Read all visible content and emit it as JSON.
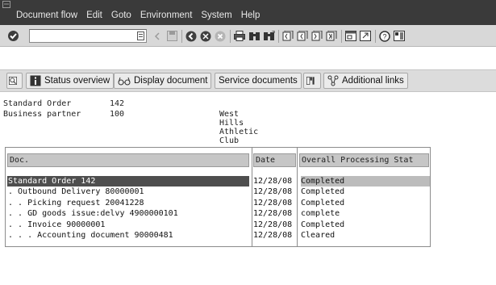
{
  "menubar": {
    "items": [
      "Document flow",
      "Edit",
      "Goto",
      "Environment",
      "System",
      "Help"
    ]
  },
  "toolbar": {
    "command_value": "",
    "icons": [
      "ok-icon",
      "back-icon",
      "exit-icon",
      "cancel-icon",
      "print-icon",
      "find-icon",
      "find-next-icon",
      "first-page-icon",
      "previous-page-icon",
      "next-page-icon",
      "last-page-icon",
      "create-session-icon",
      "shortcut-icon",
      "help-icon",
      "layout-menu-icon"
    ]
  },
  "appbar": {
    "status_overview": "Status overview",
    "display_document": "Display document",
    "service_documents": "Service documents",
    "additional_links": "Additional links"
  },
  "header": {
    "order_label": "Standard Order",
    "order_value": "142",
    "partner_label": "Business partner",
    "partner_value": "100",
    "partner_name": "West Hills Athletic Club"
  },
  "tree": {
    "columns": [
      "Doc.",
      "Date",
      "Overall Processing Stat"
    ],
    "rows": [
      {
        "doc": "Standard Order 142",
        "date": "12/28/08",
        "status": "Completed"
      },
      {
        "doc": ". Outbound Delivery 80000001",
        "date": "12/28/08",
        "status": "Completed"
      },
      {
        "doc": ". . Picking request 20041228",
        "date": "12/28/08",
        "status": "Completed"
      },
      {
        "doc": ". . GD goods issue:delvy 4900000101",
        "date": "12/28/08",
        "status": "complete"
      },
      {
        "doc": ". . Invoice 90000001",
        "date": "12/28/08",
        "status": "Completed"
      },
      {
        "doc": ". . . Accounting document 90000481",
        "date": "12/28/08",
        "status": "Cleared"
      }
    ]
  }
}
